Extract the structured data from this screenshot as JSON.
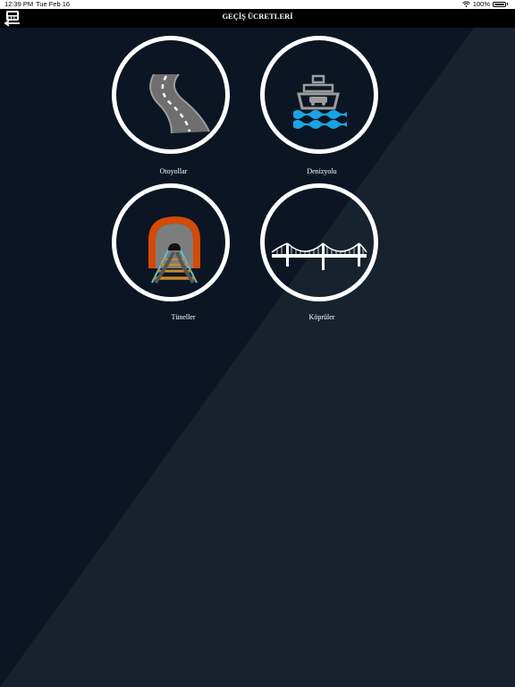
{
  "status_bar": {
    "time": "12:39 PM",
    "date": "Tue Feb 16",
    "battery": "100%"
  },
  "nav": {
    "title": "GEÇİŞ ÜCRETLERİ",
    "back_icon": "calculator-back-icon"
  },
  "colors": {
    "background_dark": "#0b1523",
    "background_light": "#17222f",
    "navbar": "#000000",
    "circle_border": "#ffffff"
  },
  "tiles": [
    {
      "label": "Otoyollar",
      "icon": "highway-road-icon"
    },
    {
      "label": "Denizyolu",
      "icon": "ferry-ship-icon"
    },
    {
      "label": "Tüneller",
      "icon": "tunnel-railway-icon"
    },
    {
      "label": "Köprüler",
      "icon": "suspension-bridge-icon"
    }
  ]
}
